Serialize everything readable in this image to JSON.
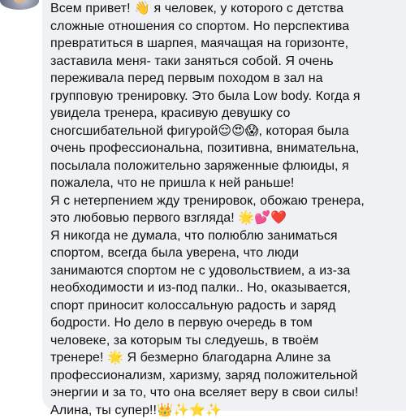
{
  "comment": {
    "lines": [
      "Всем привет! 👋 я человек, у которого с детства",
      "сложные отношения со спортом. Но перспектива",
      "превратиться в шарпея, маячащая на горизонте,",
      "заставила меня- таки заняться собой. Я очень",
      "переживала перед первым походом в зал на",
      "групповую тренировку. Это была Low body. Когда я",
      "увидела тренера, красивую девушку со",
      "сногсшибательной фигурой😌😍😱, которая была",
      "очень профессиональна, позитивна, внимательна,",
      "посылала положительно заряженные флюиды, я",
      "пожалела, что не пришла к ней раньше!",
      "Я с нетерпением жду тренировок, обожаю тренера,",
      "это любовью первого взгляда! 🌟💕❤️",
      "Я никогда не думала, что полюблю заниматься",
      "спортом, всегда была уверена, что люди",
      "занимаются спортом не с удовольствием, а из-за",
      "необходимости и из-под палки.. Но, оказывается,",
      "спорт приносит колоссальную радость и заряд",
      "бодрости. Но дело в первую очередь в том",
      "человеке, за которым ты следуешь, в твоём",
      "тренере! 🌟 Я безмерно благодарна Алине за",
      "профессионализм, харизму, заряд положительной",
      "энергии и за то, что она вселяет веру в свои силы!",
      "Алина, ты супер!!👑✨⭐✨"
    ]
  },
  "colors": {
    "bubble": "#f0f1f5",
    "text": "#111111"
  }
}
